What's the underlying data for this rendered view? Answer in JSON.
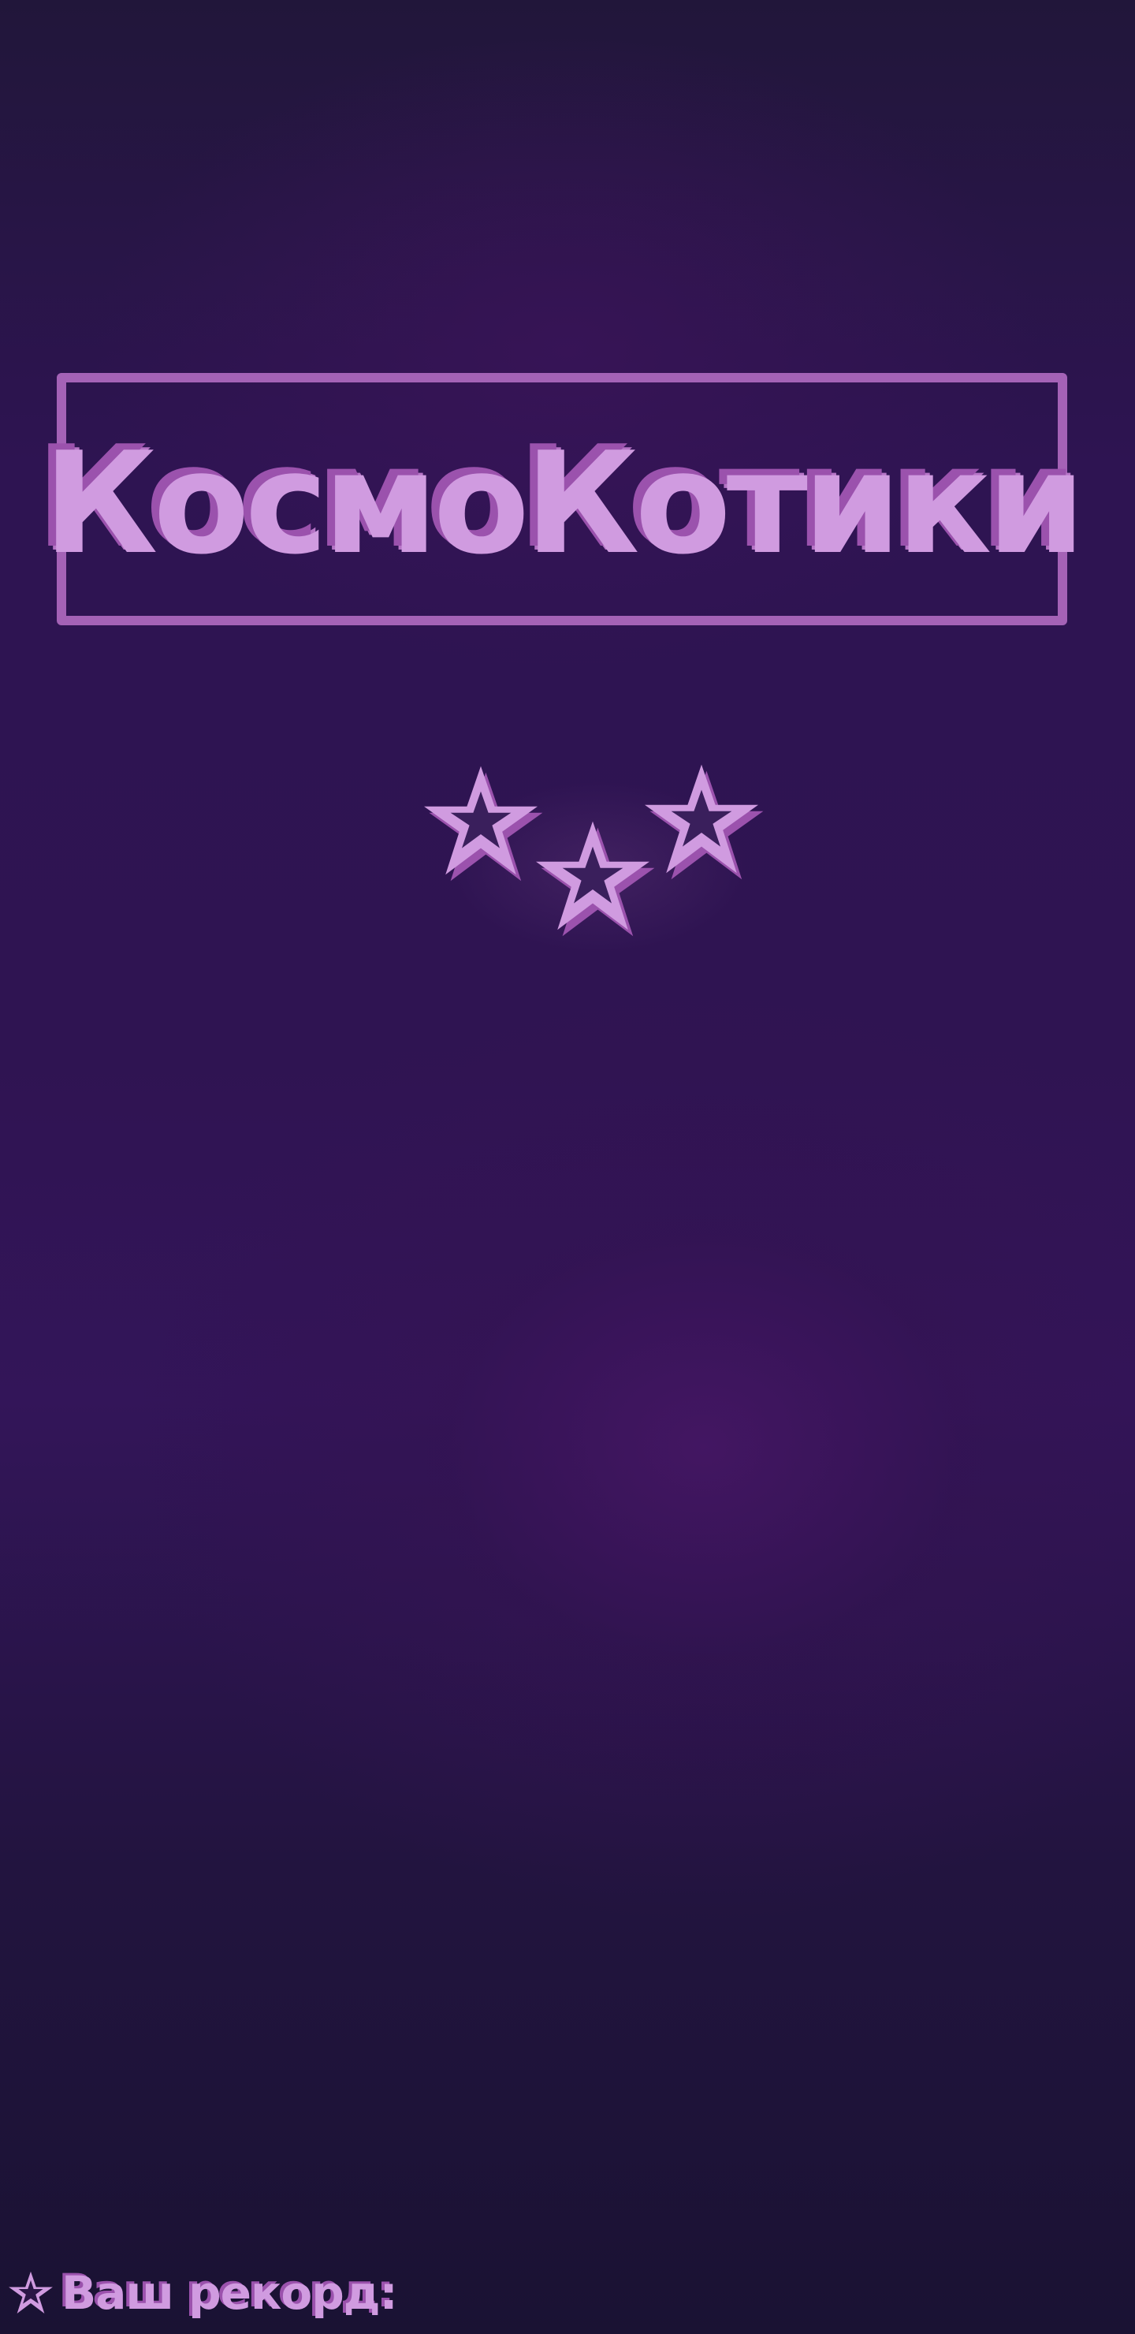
{
  "game": {
    "title": "КосмоКотики"
  },
  "rating": {
    "stars_total": 3,
    "icon": "star-outline-icon"
  },
  "record": {
    "label": "Ваш рекорд:",
    "icon": "star-icon"
  },
  "colors": {
    "background": "#2f1452",
    "accent": "#d09be0",
    "accent_shadow": "#9b52ad",
    "frame": "#a462b6",
    "star_fill": "#2d1a4c"
  }
}
